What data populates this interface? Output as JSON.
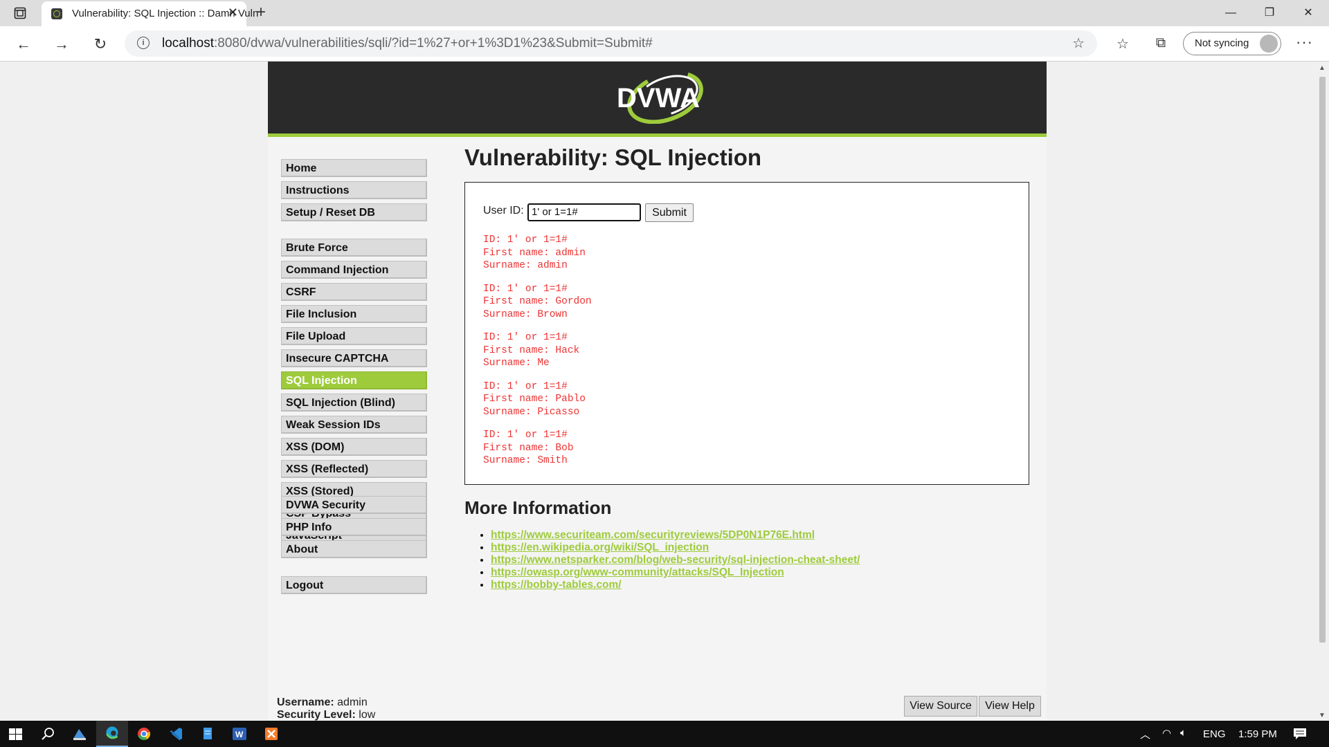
{
  "browser": {
    "tab_title": "Vulnerability: SQL Injection :: Damn Vulnerable Web Application",
    "url_host": "localhost",
    "url_rest": ":8080/dvwa/vulnerabilities/sqli/?id=1%27+or+1%3D1%23&Submit=Submit#",
    "sync_label": "Not syncing",
    "icons": [
      "back-icon",
      "forward-icon",
      "refresh-icon",
      "info-icon",
      "add-favorite-icon",
      "favorites-icon",
      "collections-icon",
      "profile-icon",
      "more-icon"
    ]
  },
  "page": {
    "title": "Vulnerability: SQL Injection",
    "menu_groups": [
      [
        "Home",
        "Instructions",
        "Setup / Reset DB"
      ],
      [
        "Brute Force",
        "Command Injection",
        "CSRF",
        "File Inclusion",
        "File Upload",
        "Insecure CAPTCHA",
        "SQL Injection",
        "SQL Injection (Blind)",
        "Weak Session IDs",
        "XSS (DOM)",
        "XSS (Reflected)",
        "XSS (Stored)",
        "CSP Bypass",
        "JavaScript"
      ],
      [
        "DVWA Security",
        "PHP Info",
        "About"
      ],
      [
        "Logout"
      ]
    ],
    "active_menu": "SQL Injection",
    "form": {
      "label": "User ID:",
      "value": "1' or 1=1#",
      "submit_label": "Submit"
    },
    "results": [
      {
        "id": "ID: 1' or 1=1#",
        "first": "First name: admin",
        "surname": "Surname: admin"
      },
      {
        "id": "ID: 1' or 1=1#",
        "first": "First name: Gordon",
        "surname": "Surname: Brown"
      },
      {
        "id": "ID: 1' or 1=1#",
        "first": "First name: Hack",
        "surname": "Surname: Me"
      },
      {
        "id": "ID: 1' or 1=1#",
        "first": "First name: Pablo",
        "surname": "Surname: Picasso"
      },
      {
        "id": "ID: 1' or 1=1#",
        "first": "First name: Bob",
        "surname": "Surname: Smith"
      }
    ],
    "more_info_title": "More Information",
    "links": [
      "https://www.securiteam.com/securityreviews/5DP0N1P76E.html",
      "https://en.wikipedia.org/wiki/SQL_injection",
      "https://www.netsparker.com/blog/web-security/sql-injection-cheat-sheet/",
      "https://owasp.org/www-community/attacks/SQL_Injection",
      "https://bobby-tables.com/"
    ],
    "footer": {
      "username_label": "Username:",
      "username": "admin",
      "security_label": "Security Level:",
      "security": "low",
      "view_source": "View Source",
      "view_help": "View Help"
    },
    "colors": {
      "accent": "#9ecb3c",
      "header": "#2a2a2a",
      "result_text": "#e33"
    }
  },
  "taskbar": {
    "apps": [
      "windows-start-icon",
      "search-icon",
      "app-icon",
      "edge-icon",
      "chrome-icon",
      "vscode-icon",
      "notepad-icon",
      "word-icon",
      "xampp-icon"
    ],
    "language": "ENG",
    "time": "1:59 PM"
  }
}
